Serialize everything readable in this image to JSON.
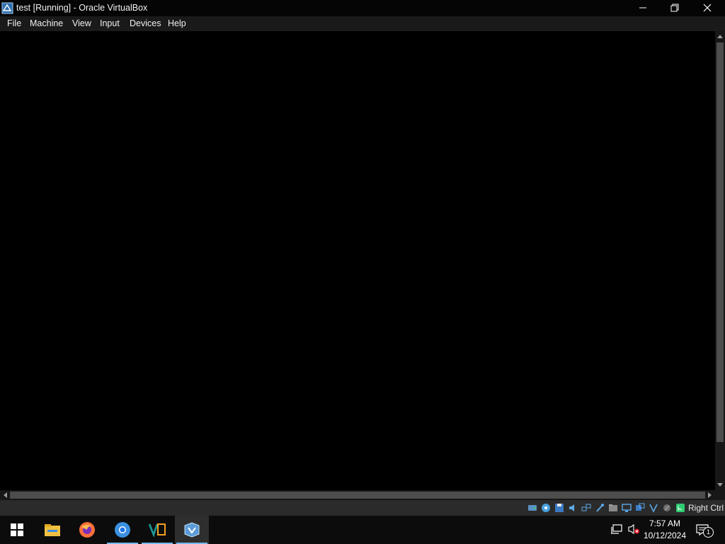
{
  "window": {
    "title": "test [Running] - Oracle VirtualBox",
    "app_icon": "virtualbox-icon",
    "controls": [
      "minimize-icon",
      "restore-icon",
      "close-icon"
    ]
  },
  "menu": {
    "items": [
      {
        "label": "File"
      },
      {
        "label": "Machine"
      },
      {
        "label": "View"
      },
      {
        "label": "Input"
      },
      {
        "label": "Devices"
      },
      {
        "label": "Help"
      }
    ]
  },
  "statusbar": {
    "icons": [
      "hard-disk-icon",
      "optical-drive-icon",
      "floppy-icon",
      "audio-icon",
      "network-icon",
      "usb-icon",
      "shared-folders-icon",
      "display-icon",
      "recording-icon",
      "cpu-icon",
      "virtualization-icon",
      "mouse-integration-icon",
      "keyboard-icon"
    ],
    "host_key": "Right Ctrl"
  },
  "taskbar": {
    "apps": [
      "start-icon",
      "file-explorer-icon",
      "firefox-icon",
      "chrome-icon",
      "vscode-icon",
      "virtualbox-icon"
    ],
    "time": "7:57 AM",
    "date": "10/12/2024",
    "notification_count": "1"
  },
  "colors": {
    "taskbar_accent": "#76b9ed",
    "menubar_bg": "#1a1a1a",
    "vm_screen": "#000000"
  }
}
